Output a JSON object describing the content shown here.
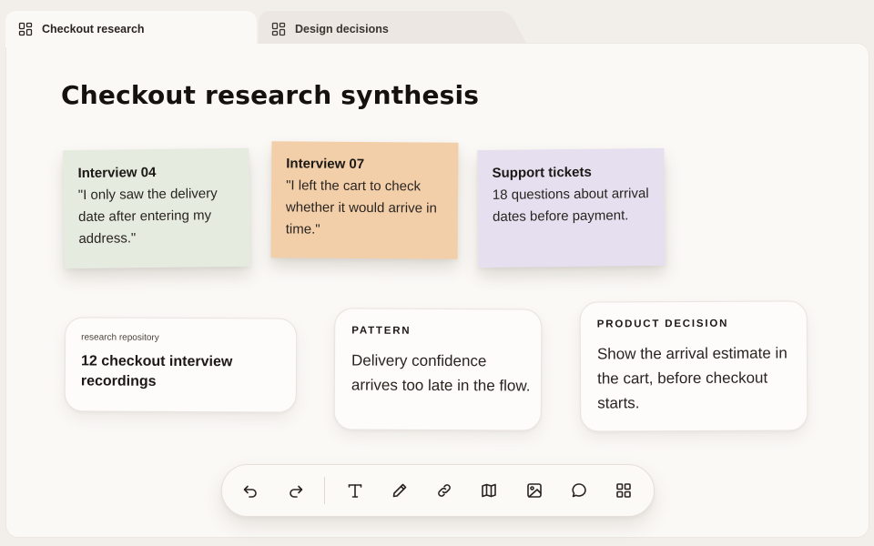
{
  "tabs": [
    {
      "label": "Checkout research",
      "icon": "board-icon",
      "active": true
    },
    {
      "label": "Design decisions",
      "icon": "board-icon",
      "active": false
    }
  ],
  "canvas": {
    "title": "Checkout research synthesis",
    "sticky_notes": [
      {
        "title": "Interview 04",
        "body": "\"I only saw the delivery date after entering my address.\"",
        "color": "#e5ecdf"
      },
      {
        "title": "Interview 07",
        "body": "\"I left the cart to check whether it would arrive in time.\"",
        "color": "#f2cfa9"
      },
      {
        "title": "Support tickets",
        "body": "18 questions about arrival dates before payment.",
        "color": "#e6dff0"
      }
    ],
    "cards": {
      "repository": {
        "label": "research repository",
        "text": "12 checkout interview recordings"
      },
      "pattern": {
        "label": "PATTERN",
        "text": "Delivery confidence arrives too late in the flow."
      },
      "decision": {
        "label": "PRODUCT DECISION",
        "text": "Show the arrival estimate in the cart, before checkout starts."
      }
    }
  },
  "toolbar": {
    "items": [
      {
        "name": "undo",
        "icon": "undo-icon"
      },
      {
        "name": "redo",
        "icon": "redo-icon"
      },
      {
        "name": "text",
        "icon": "text-icon"
      },
      {
        "name": "pen",
        "icon": "pencil-icon"
      },
      {
        "name": "link",
        "icon": "link-icon"
      },
      {
        "name": "map",
        "icon": "map-icon"
      },
      {
        "name": "image",
        "icon": "image-icon"
      },
      {
        "name": "comment",
        "icon": "comment-icon"
      },
      {
        "name": "apps",
        "icon": "grid-icon"
      }
    ]
  }
}
